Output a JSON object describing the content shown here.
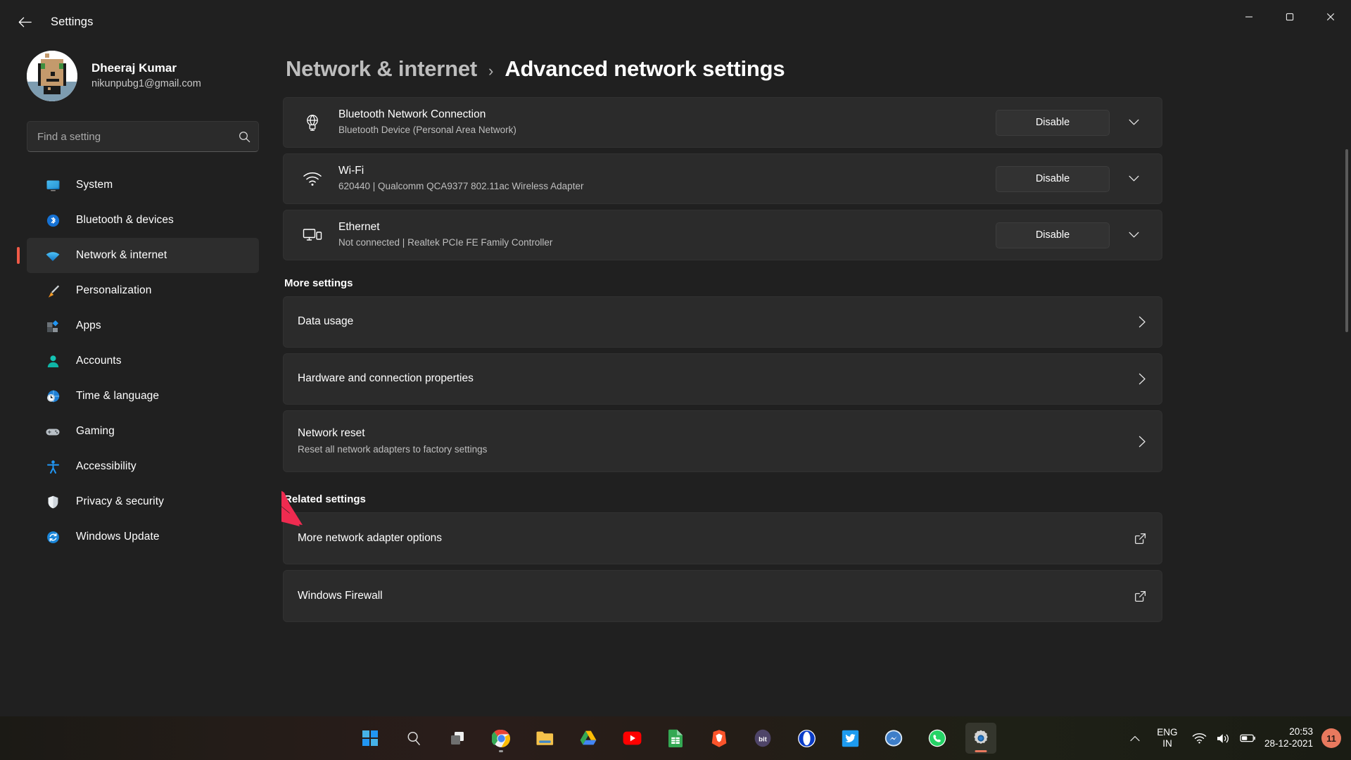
{
  "window": {
    "title": "Settings",
    "back_icon": "back-arrow-icon",
    "minimize_label": "–",
    "maximize_label": "❐",
    "close_label": "✕"
  },
  "profile": {
    "name": "Dheeraj Kumar",
    "email": "nikunpubg1@gmail.com"
  },
  "search": {
    "placeholder": "Find a setting",
    "icon": "search-icon"
  },
  "sidebar": {
    "items": [
      {
        "label": "System",
        "icon": "system-icon",
        "active": false
      },
      {
        "label": "Bluetooth & devices",
        "icon": "bluetooth-icon",
        "active": false
      },
      {
        "label": "Network & internet",
        "icon": "wifi-icon",
        "active": true
      },
      {
        "label": "Personalization",
        "icon": "paintbrush-icon",
        "active": false
      },
      {
        "label": "Apps",
        "icon": "apps-icon",
        "active": false
      },
      {
        "label": "Accounts",
        "icon": "accounts-icon",
        "active": false
      },
      {
        "label": "Time & language",
        "icon": "clock-globe-icon",
        "active": false
      },
      {
        "label": "Gaming",
        "icon": "gamepad-icon",
        "active": false
      },
      {
        "label": "Accessibility",
        "icon": "accessibility-icon",
        "active": false
      },
      {
        "label": "Privacy & security",
        "icon": "shield-icon",
        "active": false
      },
      {
        "label": "Windows Update",
        "icon": "update-icon",
        "active": false
      }
    ]
  },
  "breadcrumb": {
    "parent": "Network & internet",
    "separator": "›",
    "current": "Advanced network settings"
  },
  "adapters": [
    {
      "name": "Bluetooth Network Connection",
      "description": "Bluetooth Device (Personal Area Network)",
      "icon": "bluetooth-network-icon",
      "button": "Disable",
      "expander_icon": "chevron-down-icon"
    },
    {
      "name": "Wi-Fi",
      "description": "620440 | Qualcomm QCA9377 802.11ac Wireless Adapter",
      "icon": "wifi-icon",
      "button": "Disable",
      "expander_icon": "chevron-down-icon"
    },
    {
      "name": "Ethernet",
      "description": "Not connected | Realtek PCIe FE Family Controller",
      "icon": "ethernet-icon",
      "button": "Disable",
      "expander_icon": "chevron-down-icon"
    }
  ],
  "more_settings": {
    "heading": "More settings",
    "rows": [
      {
        "label": "Data usage",
        "sub": "",
        "icon": "chevron-right-icon"
      },
      {
        "label": "Hardware and connection properties",
        "sub": "",
        "icon": "chevron-right-icon"
      },
      {
        "label": "Network reset",
        "sub": "Reset all network adapters to factory settings",
        "icon": "chevron-right-icon"
      }
    ]
  },
  "related_settings": {
    "heading": "Related settings",
    "rows": [
      {
        "label": "More network adapter options",
        "icon": "external-link-icon"
      },
      {
        "label": "Windows Firewall",
        "icon": "external-link-icon"
      }
    ]
  },
  "annotation": {
    "type": "red-arrow",
    "color": "#ef2b50",
    "points_to": "Network reset"
  },
  "taskbar": {
    "items": [
      {
        "name": "start-button",
        "running": false
      },
      {
        "name": "search-button",
        "running": false
      },
      {
        "name": "task-view-button",
        "running": false
      },
      {
        "name": "google-chrome",
        "running": true
      },
      {
        "name": "file-explorer",
        "running": false
      },
      {
        "name": "google-drive",
        "running": false
      },
      {
        "name": "youtube",
        "running": false
      },
      {
        "name": "google-sheets",
        "running": false
      },
      {
        "name": "brave-browser",
        "running": false
      },
      {
        "name": "bit",
        "running": false
      },
      {
        "name": "opera-browser",
        "running": false
      },
      {
        "name": "twitter",
        "running": false
      },
      {
        "name": "messenger",
        "running": false
      },
      {
        "name": "whatsapp",
        "running": false
      },
      {
        "name": "settings",
        "running": true,
        "active": true
      }
    ],
    "tray": {
      "chevron_icon": "chevron-up-icon",
      "language_top": "ENG",
      "language_bottom": "IN",
      "wifi_icon": "wifi-icon",
      "volume_icon": "speaker-icon",
      "battery_icon": "battery-icon",
      "time": "20:53",
      "date": "28-12-2021",
      "notification_count": "11"
    }
  }
}
